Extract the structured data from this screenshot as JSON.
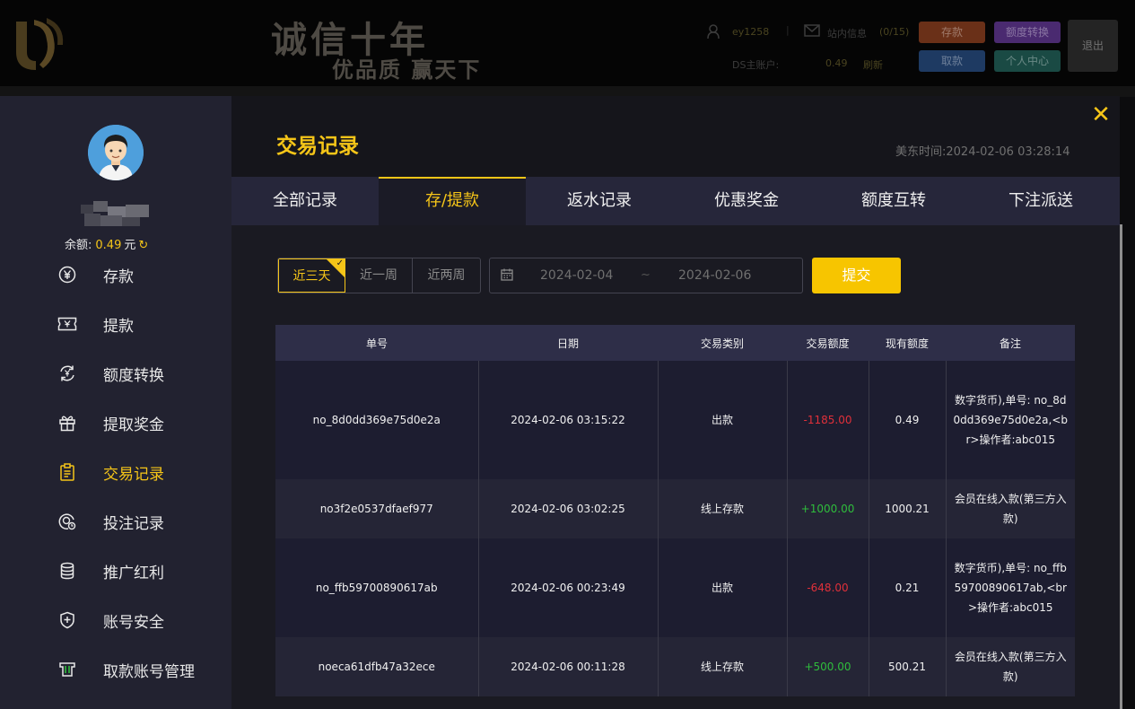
{
  "background_header": {
    "slogan_main": "诚信十年",
    "slogan_sub": "优品质 赢天下",
    "username": "ey1258",
    "messages_label": "站内信息",
    "messages_count": "(0/15)",
    "account_label": "DS主账户:",
    "account_balance": "0.49",
    "account_refresh": "刷新",
    "deposit_label": "存款",
    "transfer_label": "额度转换",
    "withdraw_label": "取款",
    "center_label": "个人中心",
    "logout_label": "退出"
  },
  "sidebar": {
    "balance_label": "余额:",
    "balance_value": "0.49",
    "balance_unit": "元",
    "items": [
      {
        "label": "存款",
        "icon": "yen-circle-icon"
      },
      {
        "label": "提款",
        "icon": "ticket-icon"
      },
      {
        "label": "额度转换",
        "icon": "exchange-icon"
      },
      {
        "label": "提取奖金",
        "icon": "gift-icon"
      },
      {
        "label": "交易记录",
        "icon": "clipboard-icon"
      },
      {
        "label": "投注记录",
        "icon": "bet-icon"
      },
      {
        "label": "推广红利",
        "icon": "coins-icon"
      },
      {
        "label": "账号安全",
        "icon": "shield-icon"
      },
      {
        "label": "取款账号管理",
        "icon": "card-icon"
      }
    ]
  },
  "header": {
    "title": "交易记录",
    "time_label": "美东时间:",
    "time_value": "2024-02-06 03:28:14"
  },
  "tabs": [
    {
      "label": "全部记录"
    },
    {
      "label": "存/提款"
    },
    {
      "label": "返水记录"
    },
    {
      "label": "优惠奖金"
    },
    {
      "label": "额度互转"
    },
    {
      "label": "下注派送"
    }
  ],
  "filters": {
    "ranges": [
      {
        "label": "近三天"
      },
      {
        "label": "近一周"
      },
      {
        "label": "近两周"
      }
    ],
    "date_start": "2024-02-04",
    "date_separator": "~",
    "date_end": "2024-02-06",
    "submit_label": "提交"
  },
  "table": {
    "columns": [
      "单号",
      "日期",
      "交易类别",
      "交易额度",
      "现有额度",
      "备注"
    ],
    "rows": [
      {
        "id": "no_8d0dd369e75d0e2a",
        "date": "2024-02-06 03:15:22",
        "type": "出款",
        "amount": "-1185.00",
        "balance": "0.49",
        "note": "数字货币),单号: no_8d0dd369e75d0e2a,<br>操作者:abc015"
      },
      {
        "id": "no3f2e0537dfaef977",
        "date": "2024-02-06 03:02:25",
        "type": "线上存款",
        "amount": "+1000.00",
        "balance": "1000.21",
        "note": "会员在线入款(第三方入款)"
      },
      {
        "id": "no_ffb59700890617ab",
        "date": "2024-02-06 00:23:49",
        "type": "出款",
        "amount": "-648.00",
        "balance": "0.21",
        "note": "数字货币),单号: no_ffb59700890617ab,<br>操作者:abc015"
      },
      {
        "id": "noeca61dfb47a32ece",
        "date": "2024-02-06 00:11:28",
        "type": "线上存款",
        "amount": "+500.00",
        "balance": "500.21",
        "note": "会员在线入款(第三方入款)"
      }
    ]
  },
  "colors": {
    "accent": "#f5c518",
    "negative": "#e0303a",
    "positive": "#2fbd3c",
    "sidebar_bg": "#222230",
    "tabs_bg": "#26263a"
  }
}
